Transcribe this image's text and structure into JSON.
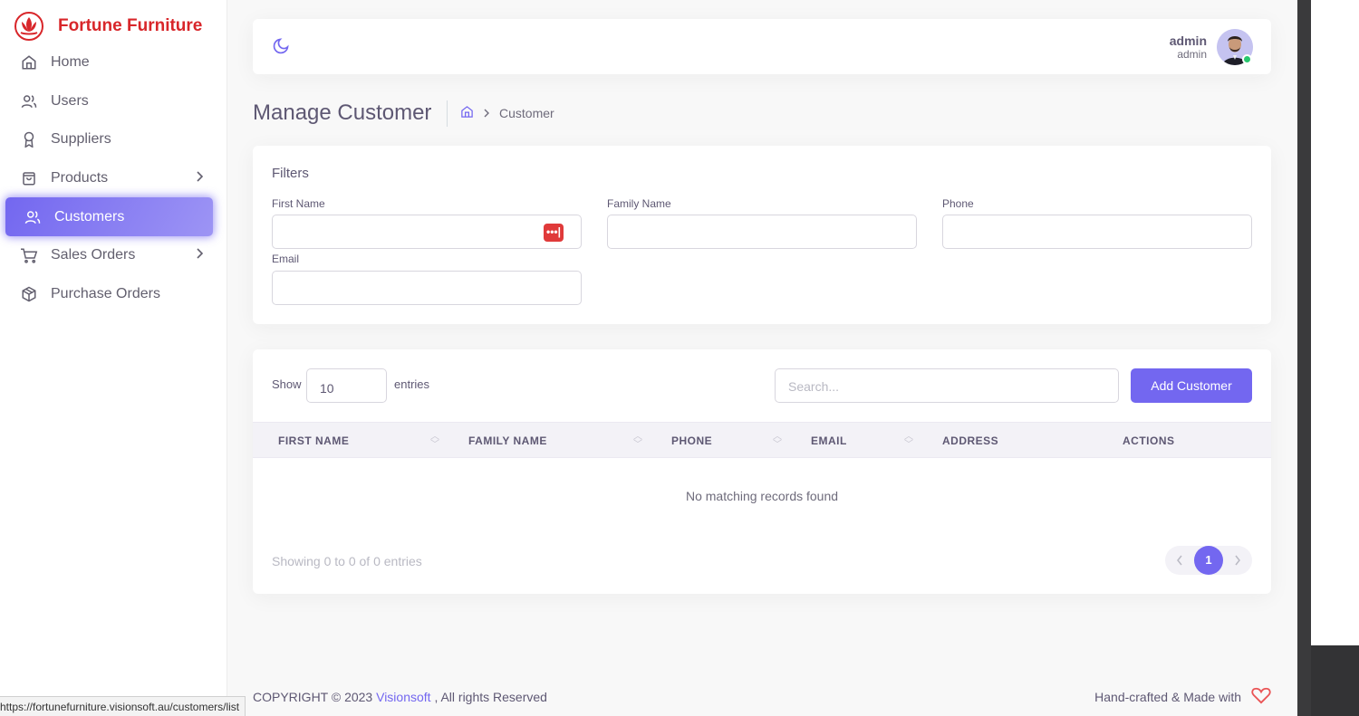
{
  "brand": {
    "name": "Fortune Furniture",
    "color": "#d8262a"
  },
  "accent": "#7367f0",
  "sidebar": {
    "items": [
      {
        "label": "Home",
        "icon": "home-icon"
      },
      {
        "label": "Users",
        "icon": "users-icon"
      },
      {
        "label": "Suppliers",
        "icon": "award-icon"
      },
      {
        "label": "Products",
        "icon": "shopping-bag-icon",
        "has_submenu": true
      },
      {
        "label": "Customers",
        "icon": "users-icon",
        "active": true
      },
      {
        "label": "Sales Orders",
        "icon": "cart-icon",
        "has_submenu": true
      },
      {
        "label": "Purchase Orders",
        "icon": "package-icon"
      }
    ]
  },
  "topbar": {
    "user_name": "admin",
    "user_role": "admin",
    "theme_icon": "moon-icon",
    "online_color": "#28c76f"
  },
  "page": {
    "title": "Manage Customer",
    "breadcrumb_current": "Customer"
  },
  "filters": {
    "title": "Filters",
    "first_name_label": "First Name",
    "family_name_label": "Family Name",
    "phone_label": "Phone",
    "email_label": "Email"
  },
  "table": {
    "show_label": "Show",
    "entries_value": "10",
    "entries_label": "entries",
    "search_placeholder": "Search...",
    "add_button": "Add Customer",
    "columns": [
      "FIRST NAME",
      "FAMILY NAME",
      "PHONE",
      "EMAIL",
      "ADDRESS",
      "ACTIONS"
    ],
    "empty_message": "No matching records found",
    "info": "Showing 0 to 0 of 0 entries",
    "current_page": "1"
  },
  "footer": {
    "copyright": "COPYRIGHT © 2023",
    "company": "Visionsoft",
    "rights": ", All rights Reserved",
    "handcrafted": "Hand-crafted & Made with"
  },
  "status_url": "https://fortunefurniture.visionsoft.au/customers/list"
}
